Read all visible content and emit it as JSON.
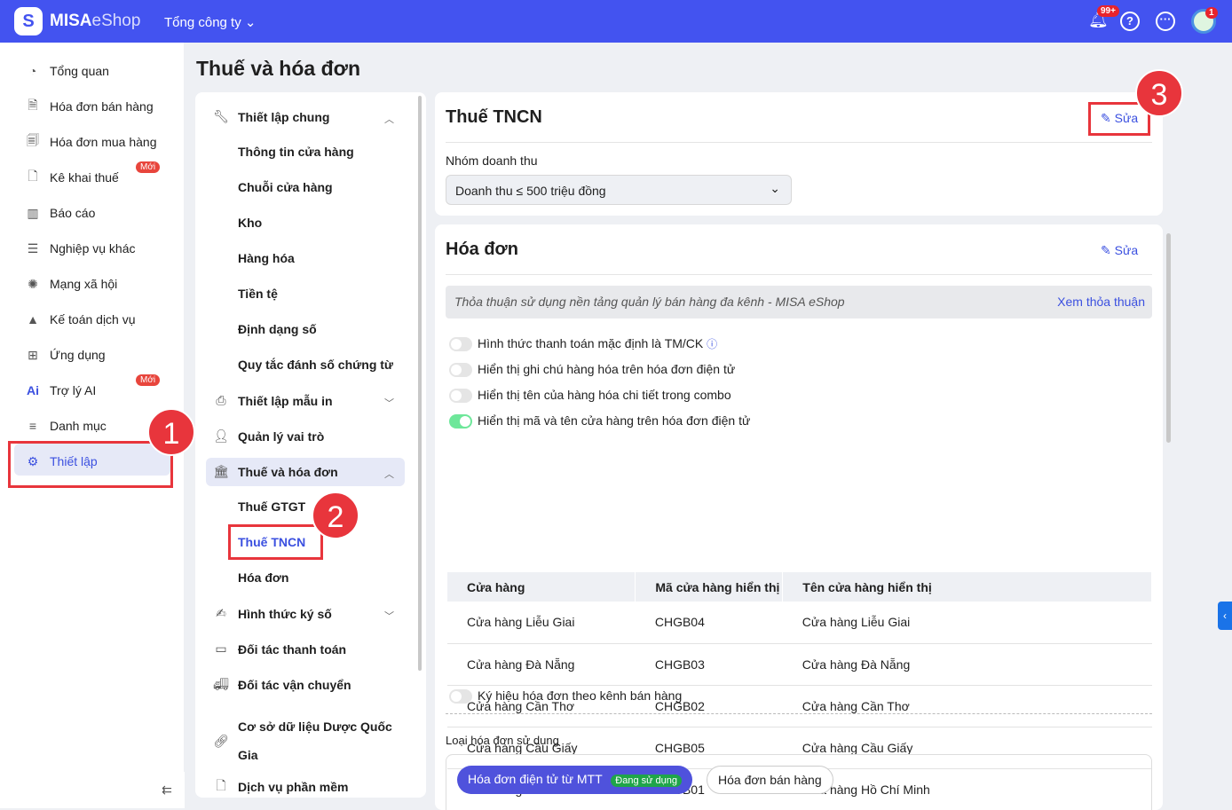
{
  "header": {
    "brand_bold": "MISA",
    "brand_light": "eShop",
    "org": "Tổng công ty",
    "notif_count": "99+",
    "avatar_badge": "1"
  },
  "sidebar": {
    "items": [
      {
        "icon": "dashboard-icon",
        "label": "Tổng quan"
      },
      {
        "icon": "invoice-icon",
        "label": "Hóa đơn bán hàng"
      },
      {
        "icon": "purchase-icon",
        "label": "Hóa đơn mua hàng"
      },
      {
        "icon": "tax-icon",
        "label": "Kê khai thuế",
        "badge": "Mới"
      },
      {
        "icon": "chart-icon",
        "label": "Báo cáo"
      },
      {
        "icon": "list-icon",
        "label": "Nghiệp vụ khác"
      },
      {
        "icon": "social-icon",
        "label": "Mạng xã hội"
      },
      {
        "icon": "accounting-icon",
        "label": "Kế toán dịch vụ"
      },
      {
        "icon": "apps-icon",
        "label": "Ứng dụng"
      },
      {
        "icon": "ai-icon",
        "label": "Trợ lý AI",
        "badge": "Mới"
      },
      {
        "icon": "menu-icon",
        "label": "Danh mục"
      },
      {
        "icon": "gear-icon",
        "label": "Thiết lập"
      }
    ]
  },
  "page_title": "Thuế và hóa đơn",
  "settings_menu": {
    "general": "Thiết lập chung",
    "general_items": [
      "Thông tin cửa hàng",
      "Chuỗi cửa hàng",
      "Kho",
      "Hàng hóa",
      "Tiền tệ",
      "Định dạng số",
      "Quy tắc đánh số chứng từ"
    ],
    "print": "Thiết lập mẫu in",
    "roles": "Quản lý vai trò",
    "tax": "Thuế và hóa đơn",
    "tax_items": [
      "Thuế GTGT",
      "Thuế TNCN",
      "Hóa đơn"
    ],
    "sign": "Hình thức ký số",
    "payment": "Đối tác thanh toán",
    "shipping": "Đối tác vận chuyển",
    "db_line1": "Cơ sở dữ liệu Dược Quốc",
    "db_line2": "Gia",
    "software": "Dịch vụ phần mềm"
  },
  "tncn": {
    "title": "Thuế TNCN",
    "edit": "Sửa",
    "group_label": "Nhóm doanh thu",
    "group_value": "Doanh thu ≤ 500 triệu đồng"
  },
  "invoice": {
    "title": "Hóa đơn",
    "edit": "Sửa",
    "agreement": "Thỏa thuận sử dụng nền tảng quản lý bán hàng đa kênh - MISA eShop",
    "agreement_link": "Xem thỏa thuận",
    "options": [
      {
        "label": "Hình thức thanh toán mặc định là TM/CK",
        "on": false
      },
      {
        "label": "Hiển thị ghi chú hàng hóa trên hóa đơn điện tử",
        "on": false
      },
      {
        "label": "Hiển thị tên của hàng hóa chi tiết trong combo",
        "on": false
      },
      {
        "label": "Hiển thị mã và tên cửa hàng trên hóa đơn điện tử",
        "on": true
      }
    ],
    "columns": [
      "Cửa hàng",
      "Mã cửa hàng hiển thị",
      "Tên cửa hàng hiển thị"
    ],
    "rows": [
      [
        "Cửa hàng Liễu Giai",
        "CHGB04",
        "Cửa hàng Liễu Giai"
      ],
      [
        "Cửa hàng Đà Nẵng",
        "CHGB03",
        "Cửa hàng Đà Nẵng"
      ],
      [
        "Cửa hàng Cần Thơ",
        "CHGB02",
        "Cửa hàng Cần Thơ"
      ],
      [
        "Cửa hàng Cầu Giấy",
        "CHGB05",
        "Cửa hàng Cầu Giấy"
      ],
      [
        "Cửa hàng Hồ Chí Minh",
        "CHGB01",
        "Cửa hàng Hồ Chí Minh"
      ]
    ],
    "symbol_option": "Ký hiệu hóa đơn theo kênh bán hàng",
    "type_label": "Loại hóa đơn sử dụng",
    "type_active": "Hóa đơn điện tử từ MTT",
    "type_active_badge": "Đang sử dụng",
    "type_other": "Hóa đơn bán hàng"
  },
  "callouts": [
    "1",
    "2",
    "3"
  ],
  "colors": {
    "primary": "#4353f0",
    "accent": "#3b50e0",
    "callout": "#e8353c"
  }
}
